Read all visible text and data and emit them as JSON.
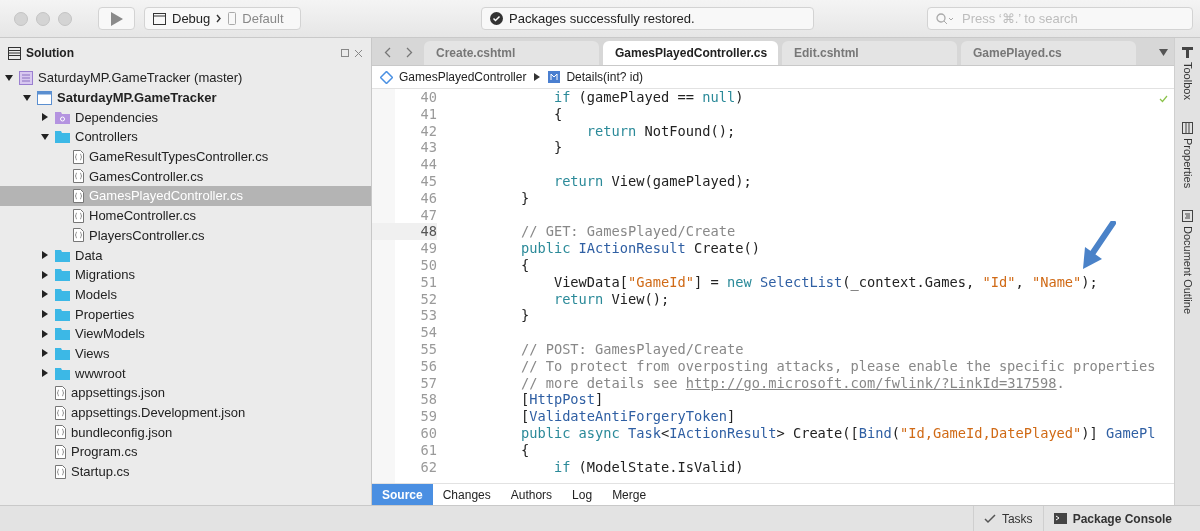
{
  "toolbar": {
    "configuration": "Debug",
    "device": "Default",
    "status": "Packages successfully restored.",
    "search": {
      "placeholder": "Press ‘⌘.’ to search"
    }
  },
  "solution_pad": {
    "title": "Solution",
    "tree": [
      {
        "kind": "solution",
        "label": "SaturdayMP.GameTracker (master)",
        "expanded": true,
        "selected": false,
        "children": [
          {
            "kind": "project",
            "label": "SaturdayMP.GameTracker",
            "expanded": true,
            "selected": false,
            "children": [
              {
                "kind": "dependencies",
                "label": "Dependencies",
                "expanded": false,
                "selected": false
              },
              {
                "kind": "folder",
                "label": "Controllers",
                "expanded": true,
                "selected": false,
                "children": [
                  {
                    "kind": "file",
                    "label": "GameResultTypesController.cs",
                    "selected": false
                  },
                  {
                    "kind": "file",
                    "label": "GamesController.cs",
                    "selected": false
                  },
                  {
                    "kind": "file",
                    "label": "GamesPlayedController.cs",
                    "selected": true
                  },
                  {
                    "kind": "file",
                    "label": "HomeController.cs",
                    "selected": false
                  },
                  {
                    "kind": "file",
                    "label": "PlayersController.cs",
                    "selected": false
                  }
                ]
              },
              {
                "kind": "folder",
                "label": "Data",
                "expanded": false,
                "selected": false
              },
              {
                "kind": "folder",
                "label": "Migrations",
                "expanded": false,
                "selected": false
              },
              {
                "kind": "folder",
                "label": "Models",
                "expanded": false,
                "selected": false
              },
              {
                "kind": "folder",
                "label": "Properties",
                "expanded": false,
                "selected": false
              },
              {
                "kind": "folder",
                "label": "ViewModels",
                "expanded": false,
                "selected": false
              },
              {
                "kind": "folder",
                "label": "Views",
                "expanded": false,
                "selected": false
              },
              {
                "kind": "folder",
                "label": "wwwroot",
                "expanded": false,
                "selected": false
              },
              {
                "kind": "file",
                "label": "appsettings.json",
                "selected": false
              },
              {
                "kind": "file",
                "label": "appsettings.Development.json",
                "selected": false
              },
              {
                "kind": "file",
                "label": "bundleconfig.json",
                "selected": false
              },
              {
                "kind": "file",
                "label": "Program.cs",
                "selected": false
              },
              {
                "kind": "file",
                "label": "Startup.cs",
                "selected": false
              }
            ]
          }
        ]
      }
    ]
  },
  "editor": {
    "tabs": [
      {
        "label": "Create.cshtml",
        "selected": false
      },
      {
        "label": "GamesPlayedController.cs",
        "selected": true
      },
      {
        "label": "Edit.cshtml",
        "selected": false
      },
      {
        "label": "GamePlayed.cs",
        "selected": false
      }
    ],
    "breadcrumb": [
      {
        "kind": "class",
        "label": "GamesPlayedController"
      },
      {
        "kind": "method",
        "label": "Details(int? id)"
      }
    ],
    "lines": [
      {
        "number": "40",
        "current": false,
        "tokens": [
          {
            "kind": "keyword",
            "text": "            if"
          },
          {
            "kind": "plain",
            "text": " (gamePlayed == "
          },
          {
            "kind": "keyword",
            "text": "null"
          },
          {
            "kind": "plain",
            "text": ")"
          }
        ]
      },
      {
        "number": "41",
        "current": false,
        "tokens": [
          {
            "kind": "plain",
            "text": "            {"
          }
        ]
      },
      {
        "number": "42",
        "current": false,
        "tokens": [
          {
            "kind": "keyword",
            "text": "                return"
          },
          {
            "kind": "plain",
            "text": " NotFound();"
          }
        ]
      },
      {
        "number": "43",
        "current": false,
        "tokens": [
          {
            "kind": "plain",
            "text": "            }"
          }
        ]
      },
      {
        "number": "44",
        "current": false
      },
      {
        "number": "45",
        "current": false,
        "tokens": [
          {
            "kind": "keyword",
            "text": "            return"
          },
          {
            "kind": "plain",
            "text": " View(gamePlayed);"
          }
        ]
      },
      {
        "number": "46",
        "current": false,
        "tokens": [
          {
            "kind": "plain",
            "text": "        }"
          }
        ]
      },
      {
        "number": "47",
        "current": false
      },
      {
        "number": "48",
        "current": true,
        "tokens": [
          {
            "kind": "comment",
            "text": "        // GET: GamesPlayed/Create"
          }
        ]
      },
      {
        "number": "49",
        "current": false,
        "tokens": [
          {
            "kind": "keyword",
            "text": "        public"
          },
          {
            "kind": "type",
            "text": " IActionResult"
          },
          {
            "kind": "plain",
            "text": " Create()"
          }
        ]
      },
      {
        "number": "50",
        "current": false,
        "tokens": [
          {
            "kind": "plain",
            "text": "        {"
          }
        ]
      },
      {
        "number": "51",
        "current": false,
        "tokens": [
          {
            "kind": "plain",
            "text": "            ViewData["
          },
          {
            "kind": "string",
            "text": "\"GameId\""
          },
          {
            "kind": "plain",
            "text": "] = "
          },
          {
            "kind": "keyword",
            "text": "new"
          },
          {
            "kind": "type",
            "text": " SelectList"
          },
          {
            "kind": "plain",
            "text": "(_context.Games, "
          },
          {
            "kind": "string",
            "text": "\"Id\""
          },
          {
            "kind": "plain",
            "text": ", "
          },
          {
            "kind": "string",
            "text": "\"Name\""
          },
          {
            "kind": "plain",
            "text": ");"
          }
        ]
      },
      {
        "number": "52",
        "current": false,
        "tokens": [
          {
            "kind": "keyword",
            "text": "            return"
          },
          {
            "kind": "plain",
            "text": " View();"
          }
        ]
      },
      {
        "number": "53",
        "current": false,
        "tokens": [
          {
            "kind": "plain",
            "text": "        }"
          }
        ]
      },
      {
        "number": "54",
        "current": false
      },
      {
        "number": "55",
        "current": false,
        "tokens": [
          {
            "kind": "comment",
            "text": "        // POST: GamesPlayed/Create"
          }
        ]
      },
      {
        "number": "56",
        "current": false,
        "tokens": [
          {
            "kind": "comment",
            "text": "        // To protect from overposting attacks, please enable the specific properties"
          }
        ]
      },
      {
        "number": "57",
        "current": false,
        "tokens": [
          {
            "kind": "comment",
            "text": "        // more details see "
          },
          {
            "kind": "link",
            "text": "http://go.microsoft.com/fwlink/?LinkId=317598"
          },
          {
            "kind": "comment",
            "text": "."
          }
        ]
      },
      {
        "number": "58",
        "current": false,
        "tokens": [
          {
            "kind": "plain",
            "text": "        ["
          },
          {
            "kind": "type",
            "text": "HttpPost"
          },
          {
            "kind": "plain",
            "text": "]"
          }
        ]
      },
      {
        "number": "59",
        "current": false,
        "tokens": [
          {
            "kind": "plain",
            "text": "        ["
          },
          {
            "kind": "type",
            "text": "ValidateAntiForgeryToken"
          },
          {
            "kind": "plain",
            "text": "]"
          }
        ]
      },
      {
        "number": "60",
        "current": false,
        "tokens": [
          {
            "kind": "keyword",
            "text": "        public"
          },
          {
            "kind": "keyword",
            "text": " async"
          },
          {
            "kind": "type",
            "text": " Task"
          },
          {
            "kind": "plain",
            "text": "<"
          },
          {
            "kind": "type",
            "text": "IActionResult"
          },
          {
            "kind": "plain",
            "text": "> Create(["
          },
          {
            "kind": "type",
            "text": "Bind"
          },
          {
            "kind": "plain",
            "text": "("
          },
          {
            "kind": "string",
            "text": "\"Id,GameId,DatePlayed\""
          },
          {
            "kind": "plain",
            "text": ")] "
          },
          {
            "kind": "type",
            "text": "GamePl"
          }
        ]
      },
      {
        "number": "61",
        "current": false,
        "tokens": [
          {
            "kind": "plain",
            "text": "        {"
          }
        ]
      },
      {
        "number": "62",
        "current": false,
        "tokens": [
          {
            "kind": "keyword",
            "text": "            if"
          },
          {
            "kind": "plain",
            "text": " (ModelState.IsValid)"
          }
        ]
      }
    ],
    "bottom_tabs": [
      {
        "label": "Source",
        "selected": true
      },
      {
        "label": "Changes",
        "selected": false
      },
      {
        "label": "Authors",
        "selected": false
      },
      {
        "label": "Log",
        "selected": false
      },
      {
        "label": "Merge",
        "selected": false
      }
    ]
  },
  "right_pads": [
    {
      "kind": "toolbox",
      "label": "Toolbox"
    },
    {
      "kind": "properties",
      "label": "Properties"
    },
    {
      "kind": "outline",
      "label": "Document Outline"
    }
  ],
  "status_bar": [
    {
      "kind": "tasks",
      "label": "Tasks"
    },
    {
      "kind": "console",
      "label": "Package Console"
    }
  ]
}
